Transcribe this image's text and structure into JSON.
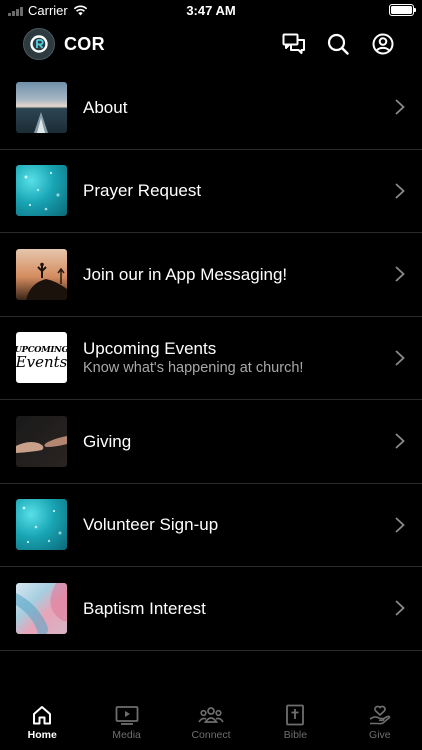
{
  "status_bar": {
    "carrier": "Carrier",
    "time": "3:47 AM"
  },
  "header": {
    "title": "COR"
  },
  "menu": [
    {
      "title": "About",
      "subtitle": ""
    },
    {
      "title": "Prayer Request",
      "subtitle": ""
    },
    {
      "title": "Join our in App Messaging!",
      "subtitle": ""
    },
    {
      "title": "Upcoming Events",
      "subtitle": "Know what's happening at church!",
      "thumb_text_1": "UPCOMING",
      "thumb_text_2": "Events"
    },
    {
      "title": "Giving",
      "subtitle": ""
    },
    {
      "title": "Volunteer Sign-up",
      "subtitle": ""
    },
    {
      "title": "Baptism Interest",
      "subtitle": ""
    }
  ],
  "tabs": [
    {
      "label": "Home",
      "icon": "home-icon",
      "active": true
    },
    {
      "label": "Media",
      "icon": "play-icon",
      "active": false
    },
    {
      "label": "Connect",
      "icon": "people-icon",
      "active": false
    },
    {
      "label": "Bible",
      "icon": "bible-icon",
      "active": false
    },
    {
      "label": "Give",
      "icon": "give-heart-icon",
      "active": false
    }
  ],
  "colors": {
    "background": "#000000",
    "divider": "#2b2b2b",
    "inactive": "#6e6e6e",
    "subtitle": "#a8a8a8"
  }
}
